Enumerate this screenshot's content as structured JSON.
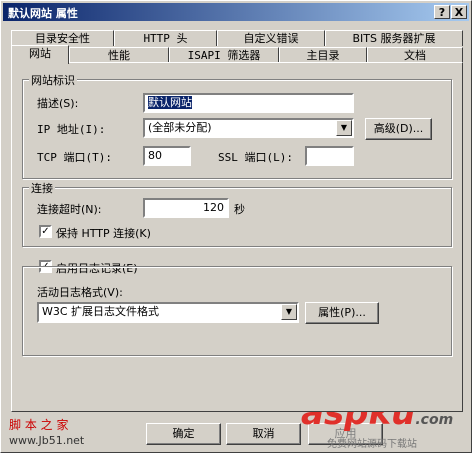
{
  "window": {
    "title": "默认网站 属性",
    "help_btn": "?",
    "close_btn": "X"
  },
  "tabs_back": [
    "目录安全性",
    "HTTP 头",
    "自定义错误",
    "BITS 服务器扩展"
  ],
  "tabs_front": [
    "网站",
    "性能",
    "ISAPI 筛选器",
    "主目录",
    "文档"
  ],
  "website_id": {
    "legend": "网站标识",
    "desc_label": "描述(S):",
    "desc_value": "默认网站",
    "ip_label": "IP 地址(I):",
    "ip_value": "(全部未分配)",
    "advanced_btn": "高级(D)...",
    "tcp_label": "TCP 端口(T):",
    "tcp_value": "80",
    "ssl_label": "SSL 端口(L):",
    "ssl_value": ""
  },
  "connection": {
    "legend": "连接",
    "timeout_label": "连接超时(N):",
    "timeout_value": "120",
    "timeout_unit": "秒",
    "keepalive_label": "保持 HTTP 连接(K)",
    "keepalive_checked": "✓"
  },
  "logging": {
    "enable_label": "启用日志记录(E)",
    "enable_checked": "✓",
    "format_label": "活动日志格式(V):",
    "format_value": "W3C 扩展日志文件格式",
    "properties_btn": "属性(P)..."
  },
  "footer": {
    "ok": "确定",
    "cancel": "取消",
    "apply": "应用"
  },
  "watermark": {
    "left_top": "脚 本 之 家",
    "left_bottom": "www.Jb51.net",
    "brand": "aspku",
    "brand_suffix": ".com",
    "brand_sub": "免费网站源码下载站"
  }
}
